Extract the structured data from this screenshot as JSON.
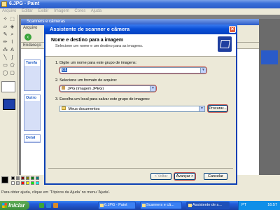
{
  "paint": {
    "title": "6.JPG - Paint",
    "menu": [
      "Arquivo",
      "Editar",
      "Exibir",
      "Imagem",
      "Cores",
      "Ajuda"
    ],
    "status": "Para obter ajuda, clique em 'Tópicos da Ajuda' no menu 'Ajuda'."
  },
  "scanner_window": {
    "title": "Scanners e câmeras",
    "menu": [
      "Arquivo"
    ],
    "address_label": "Endereço",
    "task_panes": [
      "Tarefa",
      "Outro",
      "Detal"
    ]
  },
  "dialog": {
    "title": "Assistente de scanner e câmera",
    "header_title": "Nome e destino para a imagem",
    "header_subtitle": "Selecione um nome e um destino para as imagens.",
    "step1_label": "1.  Digite um nome para este grupo de imagens:",
    "step1_value": "01",
    "step2_label": "2.  Selecione um formato de arquivo:",
    "step2_value": "JPG (Imagem JPEG)",
    "step3_label": "3.  Escolha um local para salvar este grupo de imagens:",
    "step3_value": "Meus documentos",
    "browse_button": "Procurar...",
    "back_button": "< Voltar",
    "next_button": "Avançar >",
    "cancel_button": "Cancelar"
  },
  "taskbar": {
    "start_label": "Iniciar",
    "tasks": [
      "6.JPG - Paint",
      "Scanners e câ...",
      "Assistente de s..."
    ],
    "tray_lang": "PT",
    "clock": "16:57"
  },
  "colors": {
    "title_bar": "#0a4fd8",
    "highlight": "#c0504d",
    "start_green": "#3c8f3c"
  }
}
